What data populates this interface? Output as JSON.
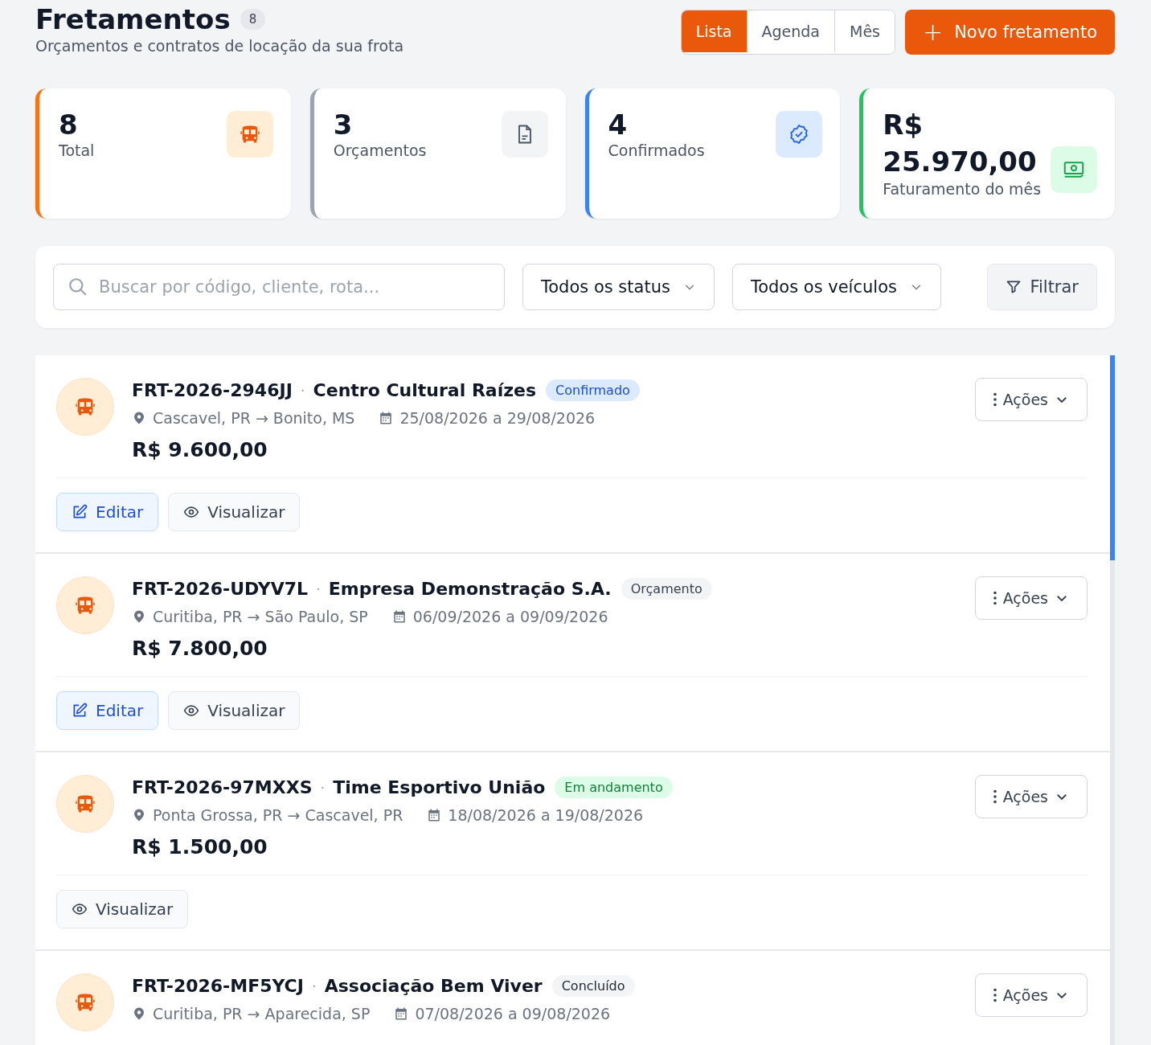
{
  "header": {
    "title": "Fretamentos",
    "count": "8",
    "subtitle": "Orçamentos e contratos de locação da sua frota"
  },
  "view_tabs": [
    {
      "label": "Lista",
      "selected": true
    },
    {
      "label": "Agenda",
      "selected": false
    },
    {
      "label": "Mês",
      "selected": false
    }
  ],
  "new_button": {
    "icon": "+",
    "label": "Novo fretamento"
  },
  "stats": [
    {
      "kind": "total",
      "value": "8",
      "label": "Total"
    },
    {
      "kind": "quotes",
      "value": "3",
      "label": "Orçamentos"
    },
    {
      "kind": "confirmed",
      "value": "4",
      "label": "Confirmados"
    },
    {
      "kind": "revenue",
      "value": "R$ 25.970,00",
      "label": "Faturamento do mês"
    }
  ],
  "filters": {
    "search": {
      "placeholder": "Buscar por código, cliente, rota..."
    },
    "status_select": "Todos os status",
    "vehicle_select": "Todos os veículos",
    "filter_button": "Filtrar"
  },
  "charters": [
    {
      "code": "FRT-2026-2946JJ",
      "separator": "·",
      "client": "Centro Cultural Raízes",
      "status": {
        "kind": "confirmed",
        "label": "Confirmado"
      },
      "route": "Cascavel, PR → Bonito, MS",
      "dates": "25/08/2026 a 29/08/2026",
      "price": "R$ 9.600,00",
      "menu": "Ações",
      "actions": [
        {
          "kind": "edit",
          "label": "Editar"
        },
        {
          "kind": "view",
          "label": "Visualizar"
        }
      ]
    },
    {
      "code": "FRT-2026-UDYV7L",
      "separator": "·",
      "client": "Empresa Demonstração S.A.",
      "status": {
        "kind": "quote",
        "label": "Orçamento"
      },
      "route": "Curitiba, PR → São Paulo, SP",
      "dates": "06/09/2026 a 09/09/2026",
      "price": "R$ 7.800,00",
      "menu": "Ações",
      "actions": [
        {
          "kind": "edit",
          "label": "Editar"
        },
        {
          "kind": "view",
          "label": "Visualizar"
        }
      ]
    },
    {
      "code": "FRT-2026-97MXXS",
      "separator": "·",
      "client": "Time Esportivo União",
      "status": {
        "kind": "in_progress",
        "label": "Em andamento"
      },
      "route": "Ponta Grossa, PR → Cascavel, PR",
      "dates": "18/08/2026 a 19/08/2026",
      "price": "R$ 1.500,00",
      "menu": "Ações",
      "actions": [
        {
          "kind": "view",
          "label": "Visualizar"
        }
      ]
    },
    {
      "code": "FRT-2026-MF5YCJ",
      "separator": "·",
      "client": "Associação Bem Viver",
      "status": {
        "kind": "done",
        "label": "Concluído"
      },
      "route": "Curitiba, PR → Aparecida, SP",
      "dates": "07/08/2026 a 09/08/2026",
      "menu": "Ações"
    }
  ]
}
